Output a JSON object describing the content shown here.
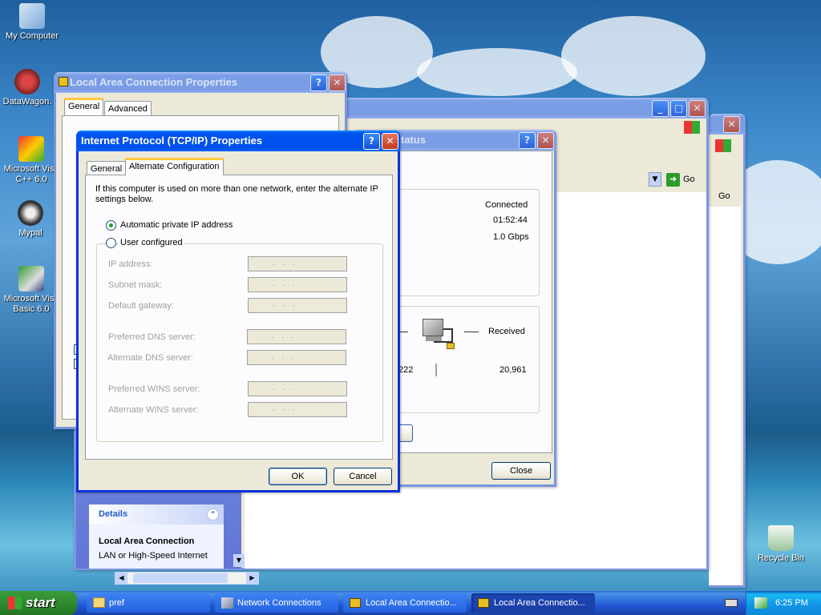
{
  "desktop": {
    "icons": [
      {
        "label": "My Computer"
      },
      {
        "label": "DataWagon."
      },
      {
        "label": "Microsoft Visu C++ 6.0"
      },
      {
        "label": "Mypal"
      },
      {
        "label": "Microsoft Visu Basic 6.0"
      },
      {
        "label": "Recycle Bin"
      }
    ]
  },
  "lac_props": {
    "title": "Local Area Connection Properties",
    "tabs": [
      "General",
      "Advanced"
    ]
  },
  "status_win": {
    "title_suffix": "tatus",
    "status_value": "Connected",
    "duration_value": "01:52:44",
    "speed_value": "1.0 Gbps",
    "received_label": "Received",
    "sent_partial": "222",
    "received_value": "20,961",
    "close_label": "Close"
  },
  "netconn": {
    "go_label": "Go",
    "details_title": "Details",
    "details_name": "Local Area Connection",
    "details_type": "LAN or High-Speed Internet"
  },
  "tcpip": {
    "title": "Internet Protocol (TCP/IP) Properties",
    "tabs": [
      "General",
      "Alternate Configuration"
    ],
    "intro": "If this computer is used on more than one network, enter the alternate IP settings below.",
    "radio_auto": "Automatic private IP address",
    "radio_user": "User configured",
    "fields": [
      {
        "label": "IP address:",
        "value": ".   .   ."
      },
      {
        "label": "Subnet mask:",
        "value": ".   .   ."
      },
      {
        "label": "Default gateway:",
        "value": ".   .   ."
      },
      {
        "label": "Preferred DNS server:",
        "value": ".   .   ."
      },
      {
        "label": "Alternate DNS server:",
        "value": ".   .   ."
      },
      {
        "label": "Preferred WINS server:",
        "value": ".   .   ."
      },
      {
        "label": "Alternate WINS server:",
        "value": ".   .   ."
      }
    ],
    "ok_label": "OK",
    "cancel_label": "Cancel"
  },
  "taskbar": {
    "start_label": "start",
    "tasks": [
      "pref",
      "Network Connections",
      "Local Area Connectio...",
      "Local Area Connectio..."
    ],
    "clock": "6:25 PM"
  }
}
